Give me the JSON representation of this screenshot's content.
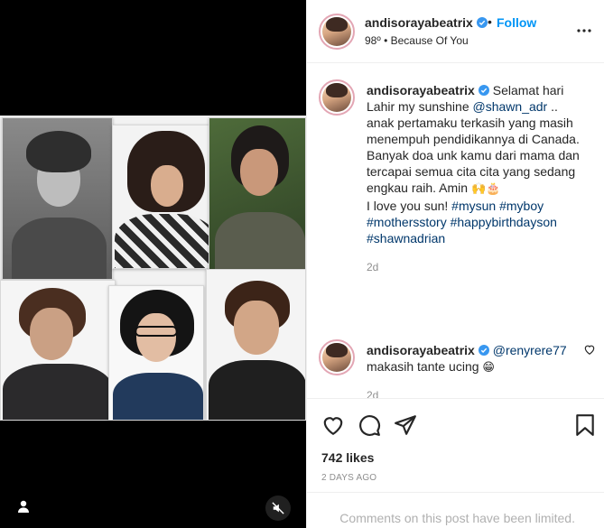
{
  "post": {
    "username": "andisorayabeatrix",
    "follow_label": "Follow",
    "separator": "•",
    "subtitle": "98º • Because Of You"
  },
  "caption": {
    "username": "andisorayabeatrix",
    "text_before_mention": "Selamat hari Lahir my sunshine ",
    "mention": "@shawn_adr",
    "text_after_mention": " .. anak pertamaku terkasih yang masih menempuh pendidikannya di Canada. Banyak doa unk kamu dari mama dan tercapai semua cita cita yang sedang engkau raih. Amin ",
    "emojis": "🙌🎂",
    "line2": "I love you sun! ",
    "hashtags": "#mysun #myboy #mothersstory #happybirthdayson #shawnadrian",
    "time": "2d"
  },
  "reply": {
    "username": "andisorayabeatrix",
    "mention": "@renyrere77",
    "text": "makasih tante ucing ",
    "emoji": "😁",
    "time": "2d"
  },
  "footer": {
    "likes": "742 likes",
    "date": "2 DAYS AGO",
    "limited_notice": "Comments on this post have been limited."
  },
  "icons": {
    "verified": "verified-badge-icon",
    "more": "more-options-icon",
    "like": "heart-icon",
    "comment": "comment-icon",
    "share": "share-icon",
    "save": "bookmark-icon",
    "user_tag": "user-tag-icon",
    "mute": "muted-speaker-icon"
  },
  "colors": {
    "accent": "#0095f6",
    "link": "#00376b",
    "muted_text": "#8e8e8e",
    "verified": "#3897f0"
  }
}
